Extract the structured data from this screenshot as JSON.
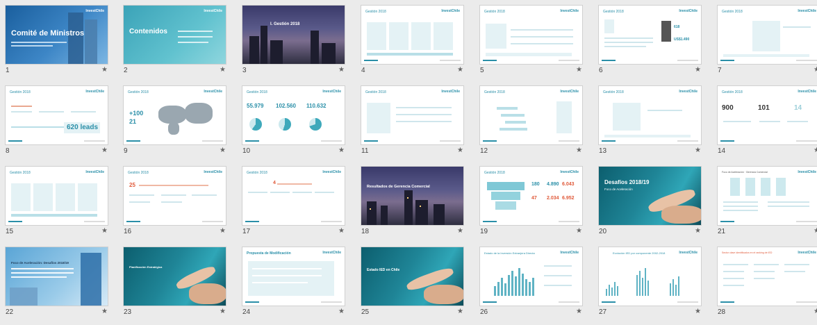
{
  "star_glyph": "★",
  "slides": [
    {
      "num": "1",
      "title": "Comité de Ministros",
      "logo": "InvestChile"
    },
    {
      "num": "2",
      "title": "Contenidos",
      "logo": "InvestChile"
    },
    {
      "num": "3",
      "title": "I. Gestión 2018"
    },
    {
      "num": "4",
      "title": "Gestión 2018",
      "logo": "InvestChile"
    },
    {
      "num": "5",
      "title": "Gestión 2018",
      "logo": "InvestChile"
    },
    {
      "num": "6",
      "title": "Gestión 2018",
      "logo": "InvestChile"
    },
    {
      "num": "7",
      "title": "Gestión 2018",
      "logo": "InvestChile"
    },
    {
      "num": "8",
      "title": "Gestión 2018",
      "logo": "InvestChile",
      "stat": "620 leads"
    },
    {
      "num": "9",
      "title": "Gestión 2018",
      "logo": "InvestChile",
      "stat": "+100",
      "stat2": "21"
    },
    {
      "num": "10",
      "title": "Gestión 2018",
      "logo": "InvestChile",
      "stat": "55.979",
      "stat2": "102.560",
      "stat3": "110.632"
    },
    {
      "num": "11",
      "title": "Gestión 2018",
      "logo": "InvestChile"
    },
    {
      "num": "12",
      "title": "Gestión 2018",
      "logo": "InvestChile"
    },
    {
      "num": "13",
      "title": "Gestión 2018",
      "logo": "InvestChile"
    },
    {
      "num": "14",
      "title": "Gestión 2018",
      "logo": "InvestChile",
      "stat": "900",
      "stat2": "101",
      "stat3": "14"
    },
    {
      "num": "15",
      "title": "Gestión 2018",
      "logo": "InvestChile"
    },
    {
      "num": "16",
      "title": "Gestión 2018",
      "logo": "InvestChile"
    },
    {
      "num": "17",
      "title": "Gestión 2018",
      "logo": "InvestChile"
    },
    {
      "num": "18",
      "title": "Resultados de Gerencia Comercial"
    },
    {
      "num": "19",
      "title": "Gestión 2018",
      "logo": "InvestChile",
      "stat": "180",
      "stat2": "4.890",
      "stat3": "6.043",
      "stat4": "47",
      "stat5": "2.034",
      "stat6": "6.952"
    },
    {
      "num": "20",
      "title": "Desafíos 2018/19",
      "subtitle": "Foco de Aceleración"
    },
    {
      "num": "21",
      "title": "Foco de Aceleración · Gerencia Comercial",
      "logo": "InvestChile"
    },
    {
      "num": "22",
      "title": "Foco de Aceleración: Desafíos 2018/19"
    },
    {
      "num": "23",
      "title": "Planificación Estratégica"
    },
    {
      "num": "24",
      "title": "Propuesta de Modificación",
      "logo": "InvestChile"
    },
    {
      "num": "25",
      "title": "Estado IED en Chile"
    },
    {
      "num": "26",
      "title": "Estado de la Inversión Extranjera Directa",
      "logo": "InvestChile"
    },
    {
      "num": "27",
      "title": "Evolución IED por componente 2002-2018",
      "logo": "InvestChile"
    },
    {
      "num": "28",
      "title": "Sector clave identificados en el ranking de IED",
      "logo": "InvestChile"
    }
  ]
}
